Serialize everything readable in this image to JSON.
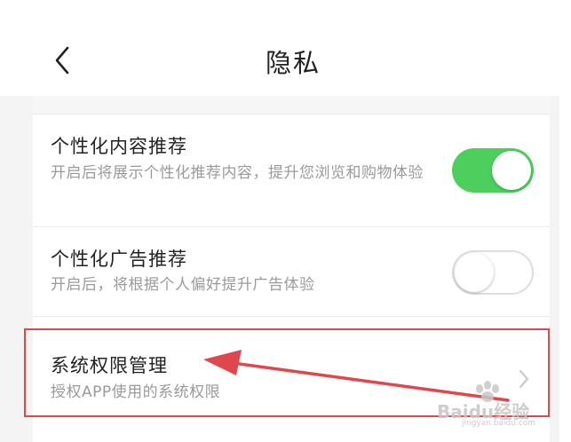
{
  "header": {
    "title": "隐私",
    "back_icon": "chevron-left-icon"
  },
  "settings": {
    "items": [
      {
        "title": "个性化内容推荐",
        "description": "开启后将展示个性化推荐内容，提升您浏览和购物体验",
        "toggle": "on"
      },
      {
        "title": "个性化广告推荐",
        "description": "开启后，将根据个人偏好提升广告体验",
        "toggle": "off"
      },
      {
        "title": "系统权限管理",
        "description": "授权APP使用的系统权限",
        "icon": "chevron-right-icon"
      }
    ]
  },
  "colors": {
    "toggle_on": "#4ccf5d",
    "annotation_red": "#e0474c"
  },
  "watermark": {
    "text": "Baidu经验",
    "sub": "jingyan.baidu.com"
  }
}
